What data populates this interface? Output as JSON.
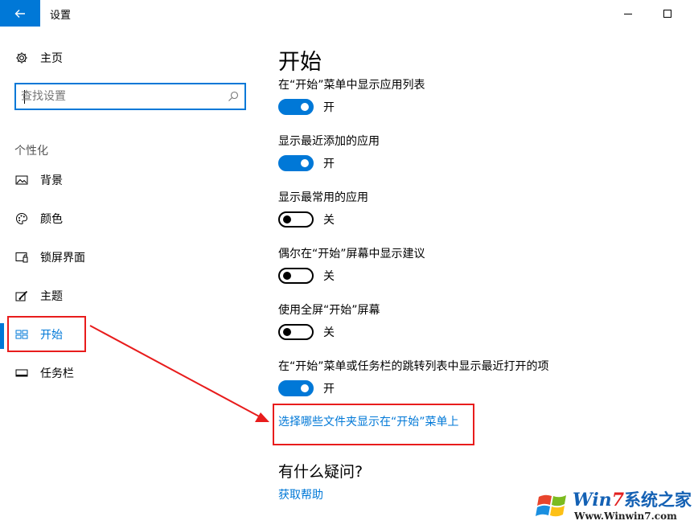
{
  "window": {
    "title": "设置",
    "back_icon": "back-arrow-icon",
    "minimize_icon": "minimize-icon",
    "maximize_icon": "maximize-icon"
  },
  "sidebar": {
    "home_label": "主页",
    "search_placeholder": "查找设置",
    "section_label": "个性化",
    "items": [
      {
        "label": "背景",
        "icon": "picture-icon"
      },
      {
        "label": "颜色",
        "icon": "palette-icon"
      },
      {
        "label": "锁屏界面",
        "icon": "lock-screen-icon"
      },
      {
        "label": "主题",
        "icon": "theme-icon"
      },
      {
        "label": "开始",
        "icon": "start-icon",
        "active": true
      },
      {
        "label": "任务栏",
        "icon": "taskbar-icon"
      }
    ]
  },
  "main": {
    "title": "开始",
    "settings": [
      {
        "label": "在“开始”菜单中显示应用列表",
        "state": "开",
        "on": true
      },
      {
        "label": "显示最近添加的应用",
        "state": "开",
        "on": true
      },
      {
        "label": "显示最常用的应用",
        "state": "关",
        "on": false
      },
      {
        "label": "偶尔在“开始”屏幕中显示建议",
        "state": "关",
        "on": false
      },
      {
        "label": "使用全屏“开始”屏幕",
        "state": "关",
        "on": false
      },
      {
        "label": "在“开始”菜单或任务栏的跳转列表中显示最近打开的项",
        "state": "开",
        "on": true
      }
    ],
    "folders_link": "选择哪些文件夹显示在“开始”菜单上",
    "help_heading": "有什么疑问?",
    "help_link": "获取帮助"
  },
  "watermark": {
    "brand_w": "Win",
    "brand_seven": "7",
    "brand_rest": "系统之家",
    "url": "Www.Winwin7.com"
  },
  "colors": {
    "accent": "#0078d7",
    "annotation": "#e81c1c"
  }
}
